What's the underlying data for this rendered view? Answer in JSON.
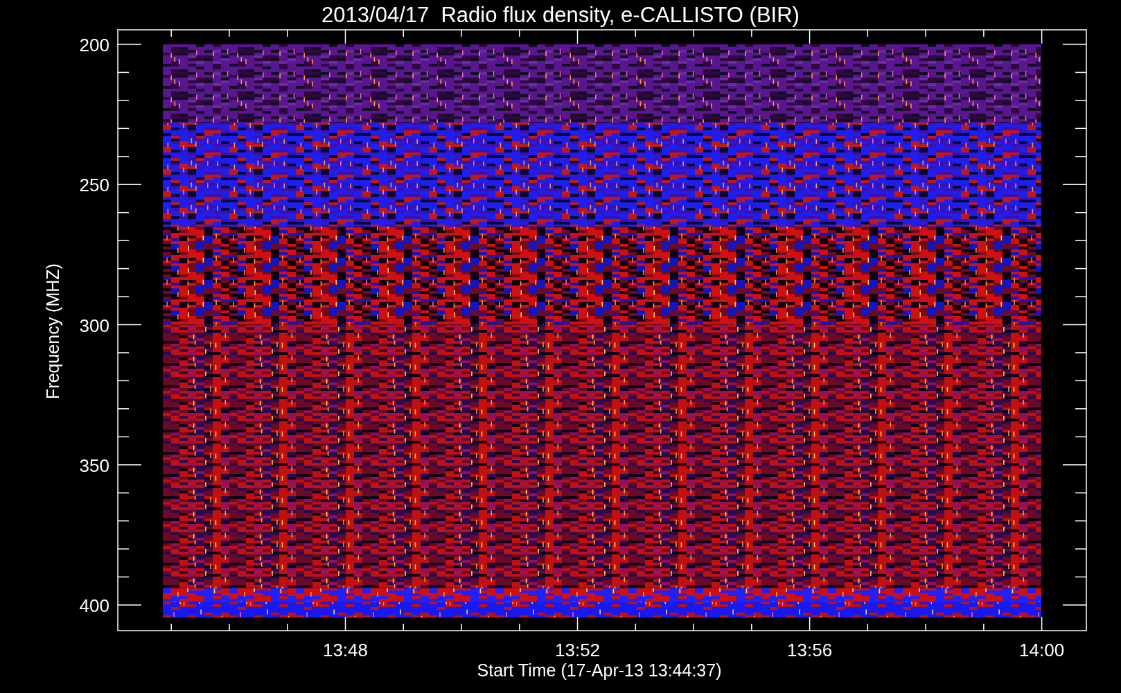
{
  "title": "2013/04/17  Radio flux density, e-CALLISTO (BIR)",
  "y_axis": {
    "label": "Frequency (MHZ)",
    "ticks": [
      "200",
      "250",
      "300",
      "350",
      "400"
    ]
  },
  "x_axis": {
    "label": "Start Time (17-Apr-13 13:44:37)",
    "ticks": [
      "13:48",
      "13:52",
      "13:56",
      "14:00"
    ]
  }
}
